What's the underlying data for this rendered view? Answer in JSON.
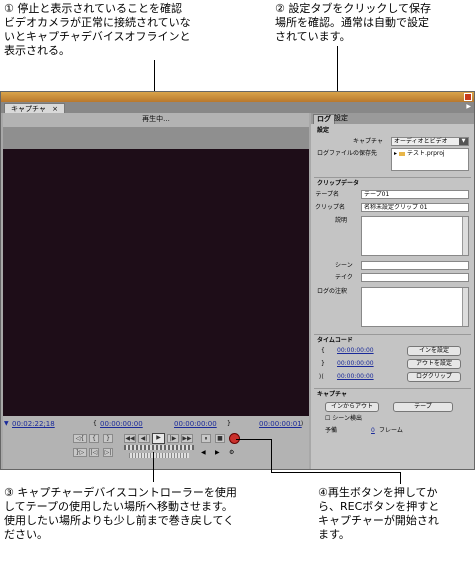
{
  "annotations": {
    "n1": [
      "① 停止と表示されていることを確認",
      "ビデオカメラが正常に接続されていな",
      "いとキャプチャデバイスオフラインと",
      "表示される。"
    ],
    "n2": [
      "② 設定タブをクリックして保存",
      "場所を確認。通常は自動で設定",
      "されています。"
    ],
    "n3": [
      "③ キャプチャーデバイスコントローラーを使用",
      "してテープの使用したい場所へ移動させます。",
      "使用したい場所よりも少し前まで巻き戻してく",
      "ださい。"
    ],
    "n4": [
      "④再生ボタンを押してか",
      "ら、RECボタンを押すと",
      "キャプチャーが開始され",
      "ます。"
    ]
  },
  "window": {
    "tab_label": "キャプチャ",
    "tab_close": "×",
    "status": "再生中..."
  },
  "timecodes": {
    "current": "00:02:22;18",
    "in": "00:00:00:00",
    "out": "00:00:00:00",
    "duration": "00:00:00:01"
  },
  "controls": {
    "play": "▶",
    "stop": "■",
    "pause": "⏸",
    "rewind": "◀◀",
    "ffwd": "▶▶",
    "step_back": "◀|",
    "step_fwd": "|▶",
    "in_mark": "{",
    "out_mark": "}"
  },
  "right": {
    "tab_log": "ログ",
    "tab_settings": "設定",
    "settings_header": "設定",
    "capture_label": "キャプチャ",
    "capture_value": "オーディオとビデオ",
    "logfile_label": "ログファイルの保存先",
    "logfile_value": "テスト.prproj",
    "clipdata_header": "クリップデータ",
    "tape_label": "テープ名",
    "tape_value": "テープ01",
    "clip_label": "クリップ名",
    "clip_value": "名称未設定クリップ 01",
    "desc_label": "説明",
    "scene_label": "シーン",
    "take_label": "テイク",
    "lognote_label": "ログの注釈",
    "timecode_header": "タイムコード",
    "tc_in": "00:00:00:00",
    "tc_out": "00:00:00:00",
    "tc_dur": "00:00:00:00",
    "btn_set_in": "インを設定",
    "btn_set_out": "アウトを設定",
    "btn_log_clip": "ログクリップ",
    "capture_header": "キャプチャ",
    "btn_inout": "インからアウト",
    "btn_tape": "テープ",
    "scene_detect": "シーン検出",
    "handles_label": "予備",
    "handles_value": "0",
    "frames_label": "フレーム"
  },
  "colors": {
    "video_bg": "#1e0d18",
    "title_accent": "#d9a44a",
    "timecode_blue": "#1a2a9a",
    "rec_red": "#c9302c"
  }
}
